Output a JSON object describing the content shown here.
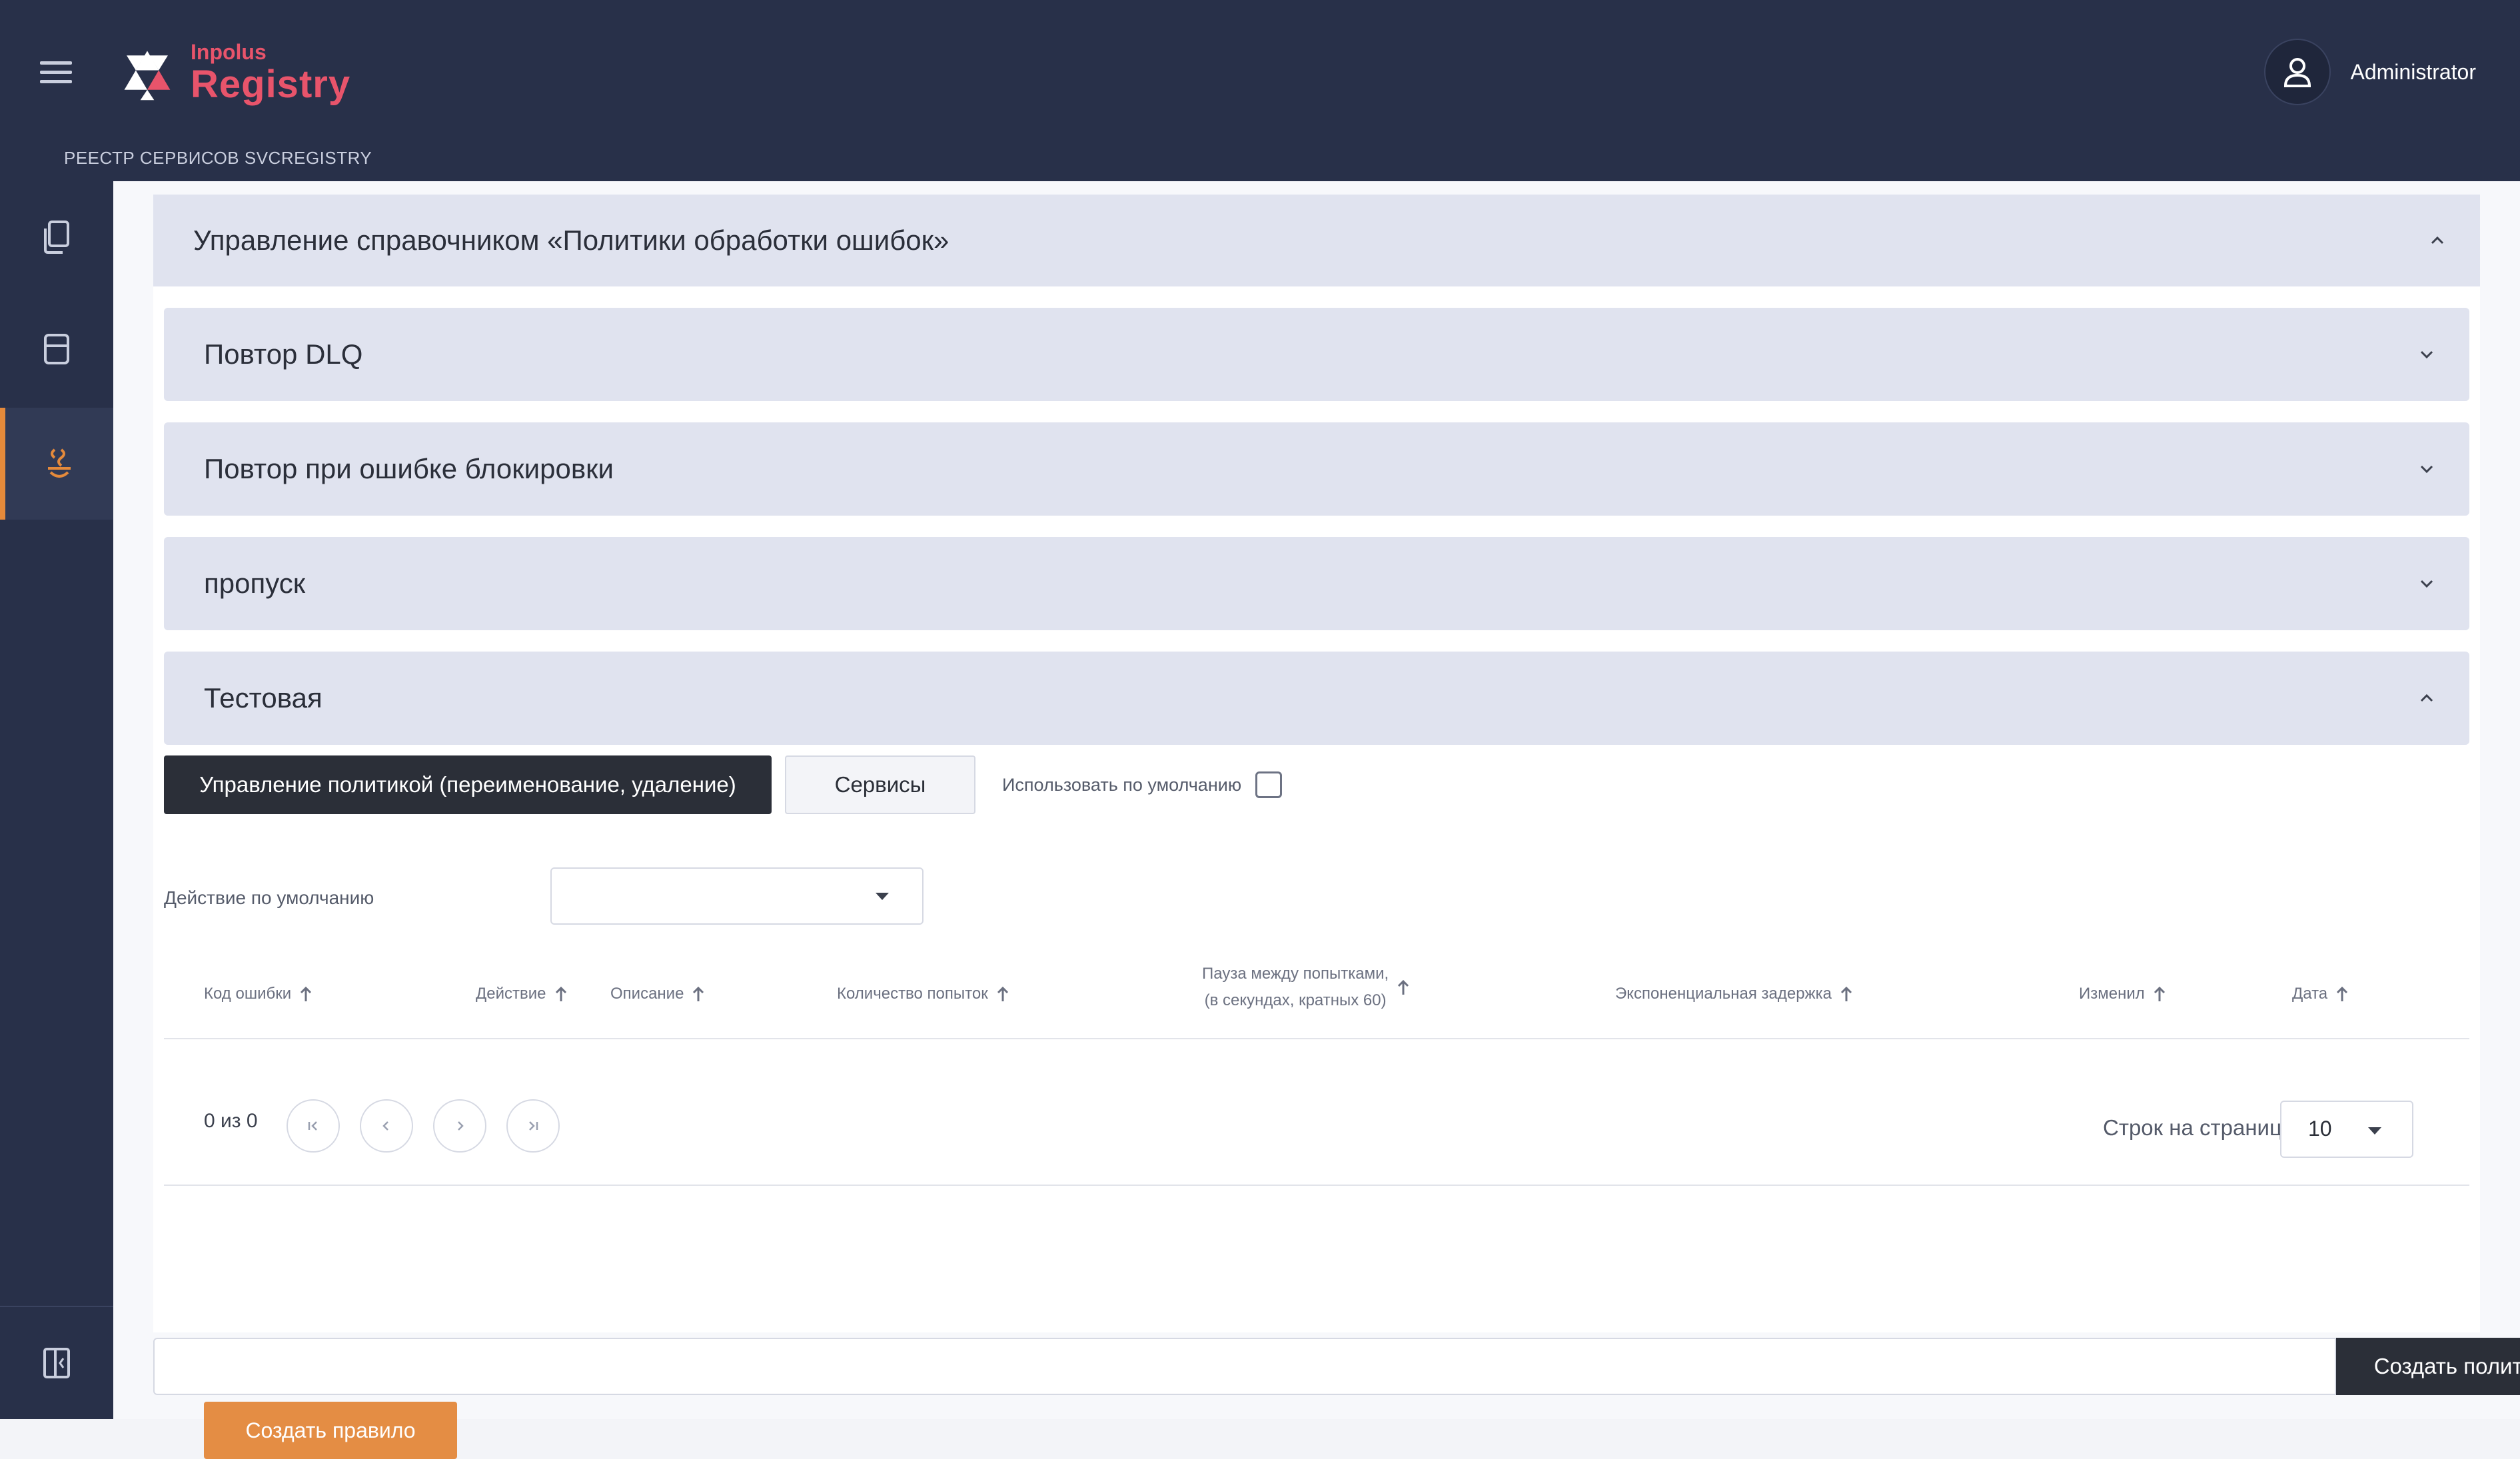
{
  "header": {
    "logo_top": "Inpolus",
    "logo_main": "Registry",
    "breadcrumb": "РЕЕСТР СЕРВИСОВ SVCREGISTRY",
    "user_name": "Administrator"
  },
  "sidebar": {
    "items": [
      {
        "icon": "documents-icon"
      },
      {
        "icon": "storage-icon"
      },
      {
        "icon": "policy-icon",
        "active": true
      }
    ],
    "bottom_icon": "collapse-sidebar-icon"
  },
  "panel": {
    "title": "Управление справочником «Политики обработки ошибок»",
    "accordions": [
      {
        "label": "Повтор DLQ",
        "expanded": false
      },
      {
        "label": "Повтор при ошибке блокировки",
        "expanded": false
      },
      {
        "label": "пропуск",
        "expanded": false
      },
      {
        "label": "Тестовая",
        "expanded": true
      }
    ],
    "manage_button": "Управление политикой (переименование, удаление)",
    "services_button": "Сервисы",
    "use_default_label": "Использовать по умолчанию",
    "use_default_checked": false,
    "default_action_label": "Действие по умолчанию",
    "default_action_value": "",
    "table": {
      "columns": [
        "Код ошибки",
        "Действие",
        "Описание",
        "Количество попыток",
        "Пауза между попытками,",
        "(в секундах, кратных 60)",
        "Экспоненциальная задержка",
        "Изменил",
        "Дата"
      ],
      "rows": []
    },
    "pagination": {
      "summary": "0 из 0",
      "rows_per_page_label": "Строк на страницу",
      "rows_per_page_value": "10"
    },
    "create_rule_button": "Создать правило"
  },
  "footer": {
    "policy_name_value": "",
    "create_policy_button": "Создать политику"
  },
  "colors": {
    "header_bg": "#283049",
    "brand": "#e8546b",
    "accent_orange": "#e48d44",
    "dark_button": "#2b2f38",
    "accordion_bg": "#e0e3ef"
  }
}
